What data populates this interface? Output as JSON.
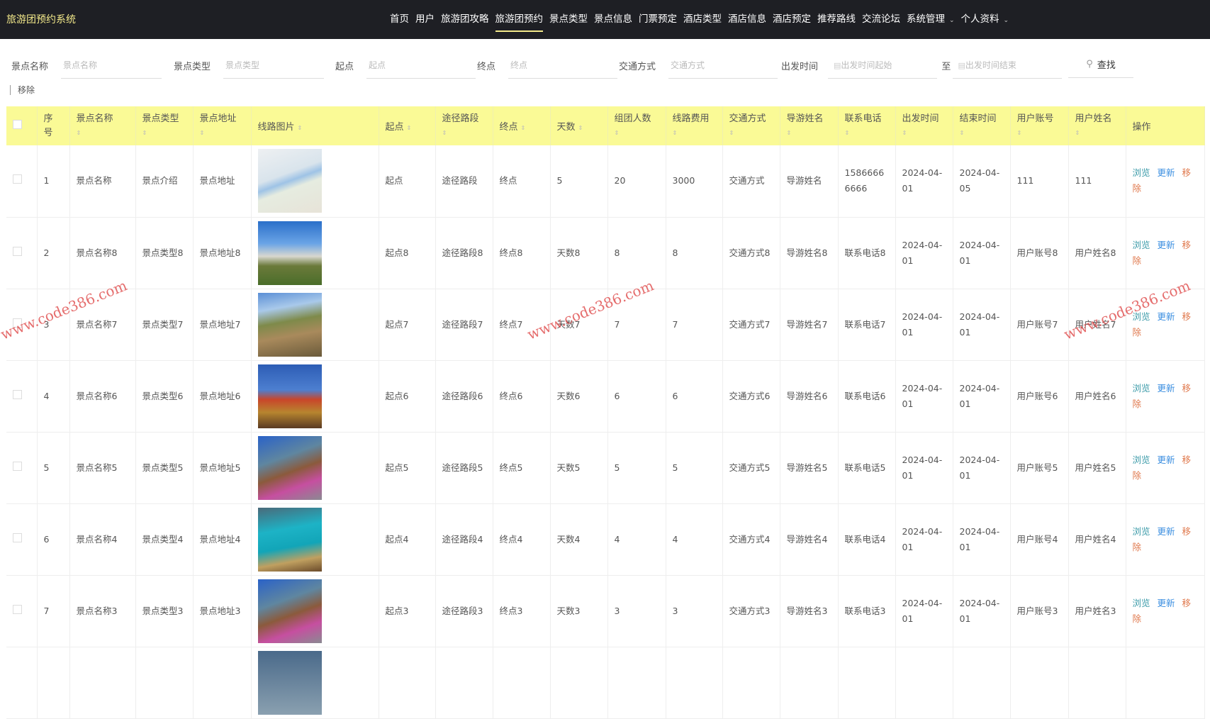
{
  "brand": "旅游团预约系统",
  "nav": [
    {
      "label": "首页"
    },
    {
      "label": "用户"
    },
    {
      "label": "旅游团攻略"
    },
    {
      "label": "旅游团预约",
      "active": true
    },
    {
      "label": "景点类型"
    },
    {
      "label": "景点信息"
    },
    {
      "label": "门票预定"
    },
    {
      "label": "酒店类型"
    },
    {
      "label": "酒店信息"
    },
    {
      "label": "酒店预定"
    },
    {
      "label": "推荐路线"
    },
    {
      "label": "交流论坛"
    },
    {
      "label": "系统管理",
      "dropdown": true
    },
    {
      "label": "个人资料",
      "dropdown": true
    }
  ],
  "search": {
    "name": {
      "label": "景点名称",
      "placeholder": "景点名称"
    },
    "type": {
      "label": "景点类型",
      "placeholder": "景点类型"
    },
    "start": {
      "label": "起点",
      "placeholder": "起点"
    },
    "end": {
      "label": "终点",
      "placeholder": "终点"
    },
    "transport": {
      "label": "交通方式",
      "placeholder": "交通方式"
    },
    "depart": {
      "label": "出发时间",
      "from_placeholder": "出发时间起始",
      "to": "至",
      "to_placeholder": "出发时间结束"
    },
    "find": "查找"
  },
  "remove_button": "移除",
  "columns": [
    "序号",
    "景点名称",
    "景点类型",
    "景点地址",
    "线路图片",
    "起点",
    "途径路段",
    "终点",
    "天数",
    "组团人数",
    "线路费用",
    "交通方式",
    "导游姓名",
    "联系电话",
    "出发时间",
    "结束时间",
    "用户账号",
    "用户姓名",
    "操作"
  ],
  "actions": {
    "view": "浏览",
    "update": "更新",
    "remove": "移除"
  },
  "colors": {
    "nav_bg": "#1e1f24",
    "brand": "#f3e98a",
    "header_bg": "#fafa96",
    "view": "#3a9aa8",
    "update": "#3a8ee0",
    "remove": "#e0784c"
  },
  "rows": [
    [
      "1",
      "景点名称",
      "景点介绍",
      "景点地址",
      "map",
      "起点",
      "途径路段",
      "终点",
      "5",
      "20",
      "3000",
      "交通方式",
      "导游姓名",
      "15866666666",
      "2024-04-01",
      "2024-04-05",
      "111",
      "111"
    ],
    [
      "2",
      "景点名称8",
      "景点类型8",
      "景点地址8",
      "rocks",
      "起点8",
      "途径路段8",
      "终点8",
      "天数8",
      "8",
      "8",
      "交通方式8",
      "导游姓名8",
      "联系电话8",
      "2024-04-01",
      "2024-04-01",
      "用户账号8",
      "用户姓名8"
    ],
    [
      "3",
      "景点名称7",
      "景点类型7",
      "景点地址7",
      "wall",
      "起点7",
      "途径路段7",
      "终点7",
      "天数7",
      "7",
      "7",
      "交通方式7",
      "导游姓名7",
      "联系电话7",
      "2024-04-01",
      "2024-04-01",
      "用户账号7",
      "用户姓名7"
    ],
    [
      "4",
      "景点名称6",
      "景点类型6",
      "景点地址6",
      "temple",
      "起点6",
      "途径路段6",
      "终点6",
      "天数6",
      "6",
      "6",
      "交通方式6",
      "导游姓名6",
      "联系电话6",
      "2024-04-01",
      "2024-04-01",
      "用户账号6",
      "用户姓名6"
    ],
    [
      "5",
      "景点名称5",
      "景点类型5",
      "景点地址5",
      "town",
      "起点5",
      "途径路段5",
      "终点5",
      "天数5",
      "5",
      "5",
      "交通方式5",
      "导游姓名5",
      "联系电话5",
      "2024-04-01",
      "2024-04-01",
      "用户账号5",
      "用户姓名5"
    ],
    [
      "6",
      "景点名称4",
      "景点类型4",
      "景点地址4",
      "lake",
      "起点4",
      "途径路段4",
      "终点4",
      "天数4",
      "4",
      "4",
      "交通方式4",
      "导游姓名4",
      "联系电话4",
      "2024-04-01",
      "2024-04-01",
      "用户账号4",
      "用户姓名4"
    ],
    [
      "7",
      "景点名称3",
      "景点类型3",
      "景点地址3",
      "town",
      "起点3",
      "途径路段3",
      "终点3",
      "天数3",
      "3",
      "3",
      "交通方式3",
      "导游姓名3",
      "联系电话3",
      "2024-04-01",
      "2024-04-01",
      "用户账号3",
      "用户姓名3"
    ]
  ],
  "watermark": "www.code386.com"
}
